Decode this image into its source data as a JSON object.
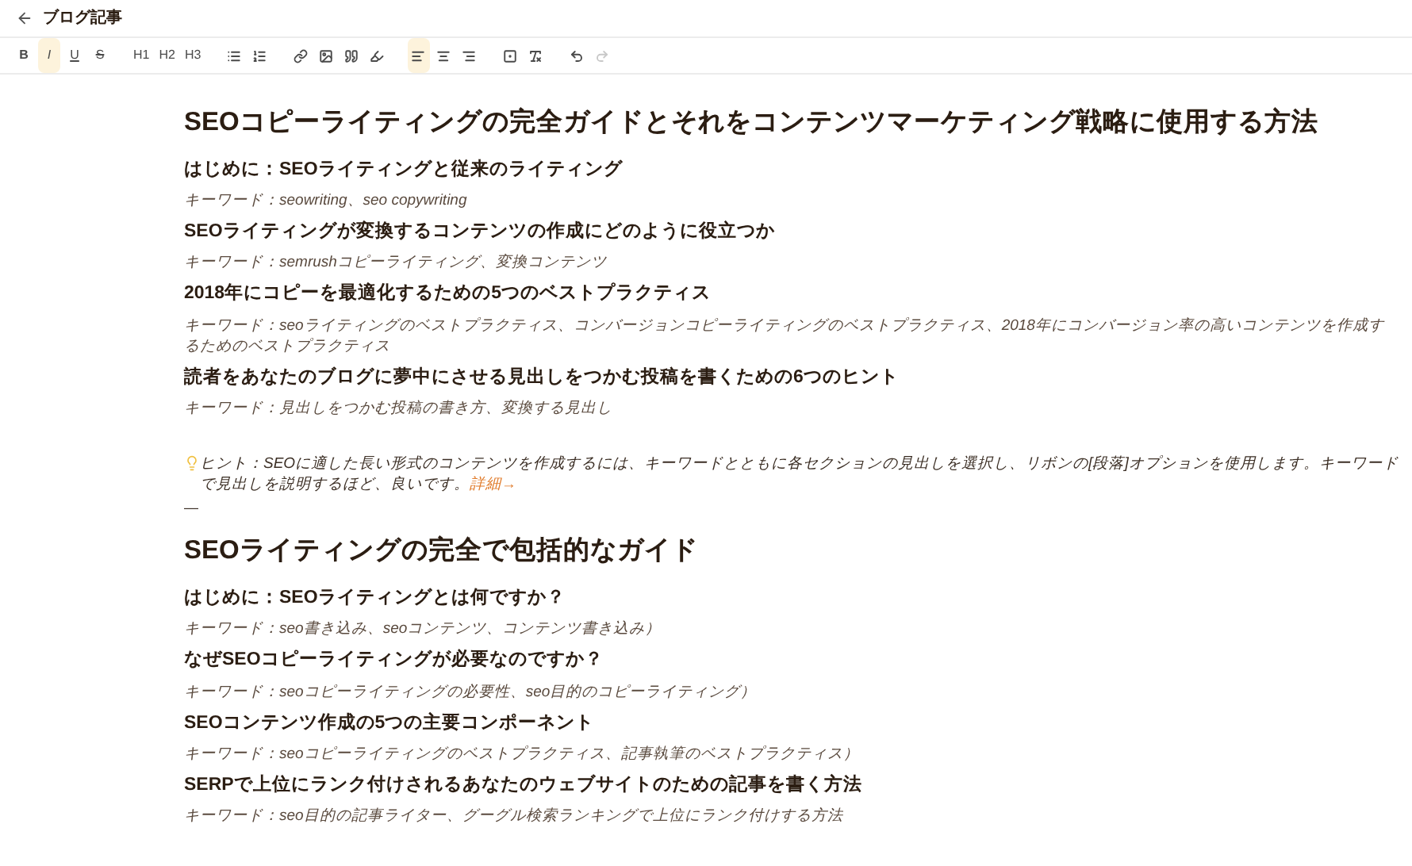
{
  "header": {
    "title": "ブログ記事"
  },
  "toolbar": [
    [
      {
        "kind": "text",
        "label": "B",
        "selected": false
      },
      {
        "kind": "text",
        "label": "I",
        "selected": true
      },
      {
        "kind": "text",
        "label": "U",
        "selected": false
      },
      {
        "kind": "text",
        "label": "S",
        "selected": false
      }
    ],
    [
      {
        "kind": "text",
        "label": "H1",
        "selected": false
      },
      {
        "kind": "text",
        "label": "H2",
        "selected": false
      },
      {
        "kind": "text",
        "label": "H3",
        "selected": false
      }
    ],
    [
      {
        "kind": "icon",
        "selected": false
      },
      {
        "kind": "icon",
        "selected": false
      }
    ],
    [
      {
        "kind": "icon",
        "selected": false
      },
      {
        "kind": "icon",
        "selected": false
      },
      {
        "kind": "icon",
        "selected": false
      },
      {
        "kind": "icon",
        "selected": false
      }
    ],
    [
      {
        "kind": "icon",
        "selected": true
      },
      {
        "kind": "icon",
        "selected": false
      },
      {
        "kind": "icon",
        "selected": false
      }
    ],
    [
      {
        "kind": "icon",
        "selected": false
      },
      {
        "kind": "icon",
        "selected": false
      }
    ],
    [
      {
        "kind": "icon",
        "selected": false,
        "disabled": false
      },
      {
        "kind": "icon",
        "selected": false,
        "disabled": true
      }
    ]
  ],
  "content": [
    {
      "kind": "h1",
      "text": "SEOコピーライティングの完全ガイドとそれをコンテンツマーケティング戦略に使用する方法"
    },
    {
      "kind": "h2",
      "text": "はじめに：SEOライティングと従来のライティング"
    },
    {
      "kind": "keywords",
      "text": "キーワード：seowriting、seo copywriting"
    },
    {
      "kind": "h2",
      "text": "SEOライティングが変換するコンテンツの作成にどのように役立つか"
    },
    {
      "kind": "keywords",
      "text": "キーワード：semrushコピーライティング、変換コンテンツ"
    },
    {
      "kind": "h2",
      "text": "2018年にコピーを最適化するための5つのベストプラクティス"
    },
    {
      "kind": "keywords",
      "text": "キーワード：seoライティングのベストプラクティス、コンバージョンコピーライティングのベストプラクティス、2018年にコンバージョン率の高いコンテンツを作成するためのベストプラクティス"
    },
    {
      "kind": "h2",
      "text": "読者をあなたのブログに夢中にさせる見出しをつかむ投稿を書くための6つのヒント"
    },
    {
      "kind": "keywords",
      "text": "キーワード：見出しをつかむ投稿の書き方、変換する見出し"
    },
    {
      "kind": "tip",
      "text": "ヒント：SEOに適した長い形式のコンテンツを作成するには、キーワードとともに各セクションの見出しを選択し、リボンの[段落]オプションを使用します。キーワードで見出しを説明するほど、良いです。",
      "link": "詳細→"
    },
    {
      "kind": "rule",
      "text": "—"
    },
    {
      "kind": "h1",
      "text": "SEOライティングの完全で包括的なガイド"
    },
    {
      "kind": "h2",
      "text": "はじめに：SEOライティングとは何ですか？"
    },
    {
      "kind": "keywords",
      "text": "キーワード：seo書き込み、seoコンテンツ、コンテンツ書き込み）"
    },
    {
      "kind": "h2",
      "text": "なぜSEOコピーライティングが必要なのですか？"
    },
    {
      "kind": "keywords",
      "text": "キーワード：seoコピーライティングの必要性、seo目的のコピーライティング）"
    },
    {
      "kind": "h2",
      "text": "SEOコンテンツ作成の5つの主要コンポーネント"
    },
    {
      "kind": "keywords",
      "text": "キーワード：seoコピーライティングのベストプラクティス、記事執筆のベストプラクティス）"
    },
    {
      "kind": "h2",
      "text": "SERPで上位にランク付けされるあなたのウェブサイトのための記事を書く方法"
    },
    {
      "kind": "keywords",
      "text": "キーワード：seo目的の記事ライター、グーグル検索ランキングで上位にランク付けする方法"
    }
  ]
}
